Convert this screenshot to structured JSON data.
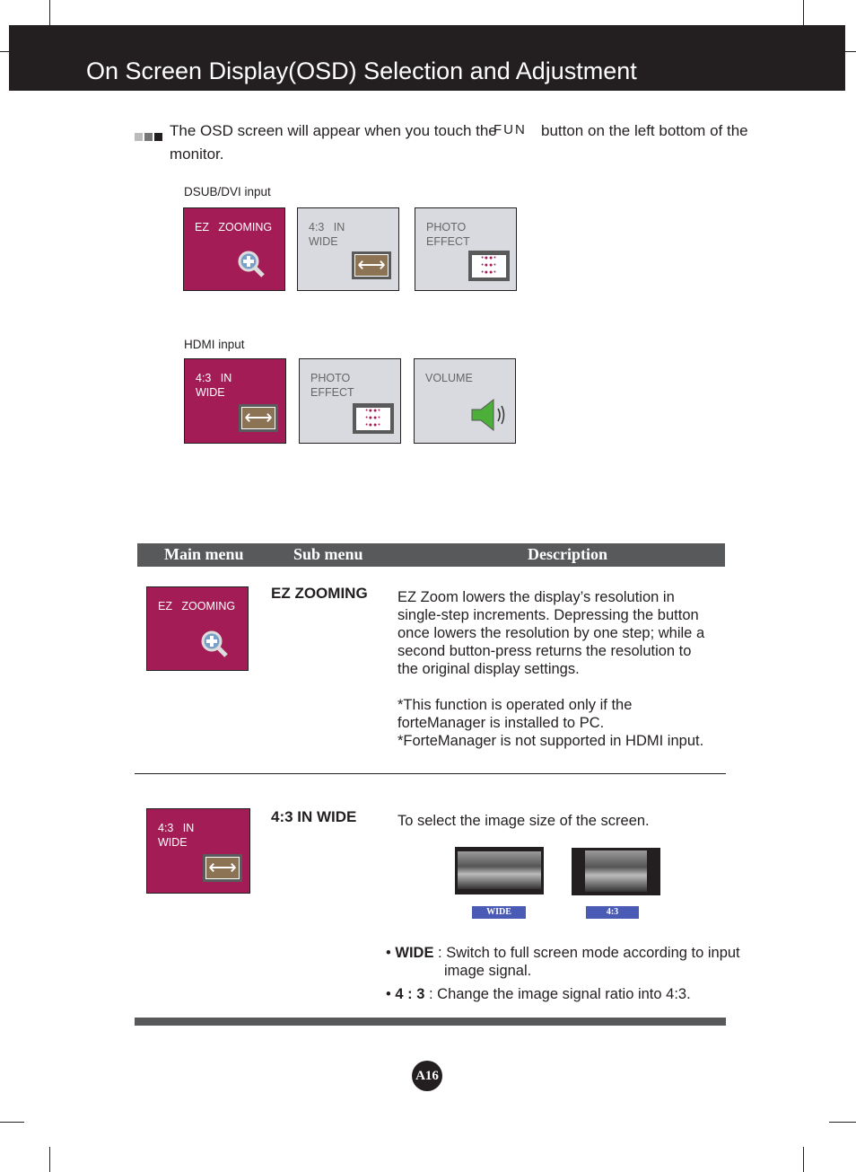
{
  "header": {
    "title": "On Screen Display(OSD) Selection and Adjustment"
  },
  "intro": {
    "text_before": "The OSD screen will appear when you touch the",
    "button_glyph": "FUN",
    "text_after": "button on the left bottom of the",
    "text_line2": "monitor."
  },
  "dsub": {
    "label": "DSUB/DVI input",
    "tiles": [
      {
        "text": "EZ   ZOOMING",
        "icon": "magnifier-plus-icon"
      },
      {
        "text": "4:3   IN\nWIDE",
        "icon": "double-arrow-icon"
      },
      {
        "text": "PHOTO\nEFFECT",
        "icon": "dots-pattern-icon"
      }
    ]
  },
  "hdmi": {
    "label": "HDMI input",
    "tiles": [
      {
        "text": "4:3   IN\nWIDE",
        "icon": "double-arrow-icon"
      },
      {
        "text": "PHOTO\nEFFECT",
        "icon": "dots-pattern-icon"
      },
      {
        "text": "VOLUME",
        "icon": "speaker-icon"
      }
    ]
  },
  "table": {
    "headers": [
      "Main menu",
      "Sub menu",
      "Description"
    ],
    "rows": [
      {
        "tile_text": "EZ   ZOOMING",
        "sub": "EZ ZOOMING",
        "desc": "EZ Zoom lowers the display’s resolution in\nsingle-step increments. Depressing the button\nonce lowers the resolution by one step; while a\nsecond button-press returns the resolution to\nthe original display settings.\n\n*This function is operated only if the\nforteManager is installed to PC.\n*ForteManager is not supported in HDMI input."
      },
      {
        "tile_text": "4:3   IN\nWIDE",
        "sub": "4:3 IN WIDE",
        "desc": "To select the image size of the screen.",
        "images": [
          "WIDE",
          "4:3"
        ],
        "bullets": [
          {
            "key": "WIDE",
            "text": " : Switch to full screen mode according to input",
            "cont": "image signal."
          },
          {
            "key": "4 : 3",
            "text": " : Change the image signal ratio into 4:3."
          }
        ]
      }
    ]
  },
  "page_number": "A16",
  "colors": {
    "accent": "#a31c55",
    "header": "#231f20",
    "tag": "#4a5bb5"
  }
}
